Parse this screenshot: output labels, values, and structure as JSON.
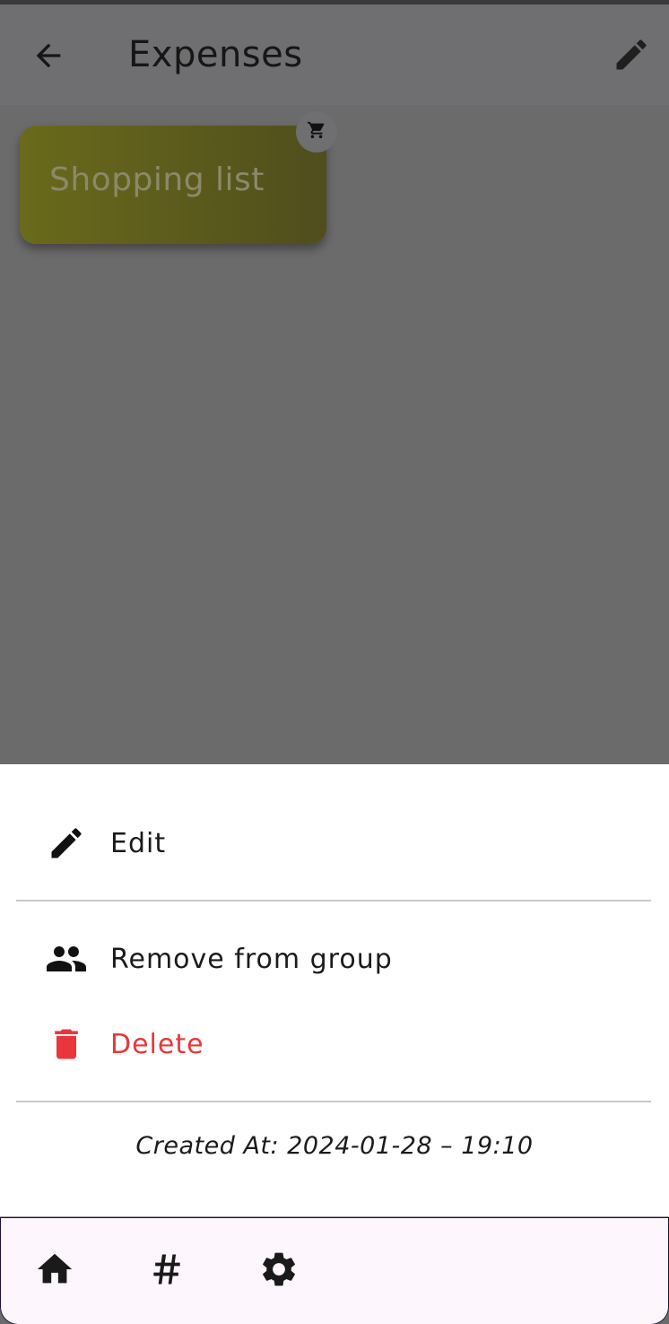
{
  "appbar": {
    "title": "Expenses",
    "back_icon": "arrow-back-icon",
    "edit_icon": "pencil-icon"
  },
  "group_card": {
    "label": "Shopping list",
    "badge_icon": "shopping-cart-icon",
    "color": "#6a6a1b"
  },
  "sheet": {
    "items": [
      {
        "label": "Edit",
        "icon": "pencil-icon"
      },
      {
        "label": "Remove from group",
        "icon": "people-icon"
      },
      {
        "label": "Delete",
        "icon": "trash-icon",
        "color": "#e8363a"
      }
    ],
    "created_at": "Created At: 2024-01-28 – 19:10"
  },
  "bottom_nav": {
    "items": [
      {
        "icon": "home-icon"
      },
      {
        "icon": "hashtag-icon"
      },
      {
        "icon": "gear-icon"
      }
    ]
  }
}
